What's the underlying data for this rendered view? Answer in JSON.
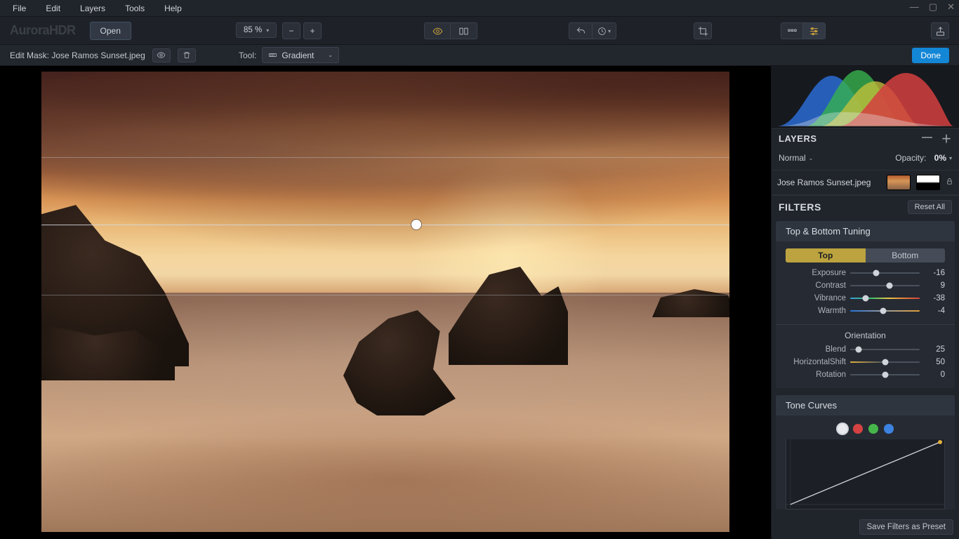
{
  "menubar": {
    "items": [
      "File",
      "Edit",
      "Layers",
      "Tools",
      "Help"
    ]
  },
  "app_logo": "AuroraHDR",
  "toolbar": {
    "open_label": "Open",
    "zoom_label": "85 %"
  },
  "subbar": {
    "editmask_prefix": "Edit Mask:",
    "filename": "Jose Ramos Sunset.jpeg",
    "tool_lbl": "Tool:",
    "tool_value": "Gradient",
    "done_label": "Done"
  },
  "layers": {
    "title": "LAYERS",
    "blend_mode": "Normal",
    "opacity_lbl": "Opacity:",
    "opacity_val": "0%",
    "layer_name": "Jose Ramos Sunset.jpeg"
  },
  "filters": {
    "title": "FILTERS",
    "reset_label": "Reset All",
    "save_preset_label": "Save Filters as Preset",
    "tbt": {
      "header": "Top & Bottom Tuning",
      "tab_top": "Top",
      "tab_bottom": "Bottom",
      "rows": [
        {
          "label": "Exposure",
          "value": "-16",
          "pos": 37
        },
        {
          "label": "Contrast",
          "value": "9",
          "pos": 57
        },
        {
          "label": "Vibrance",
          "value": "-38",
          "pos": 22,
          "track": "vib"
        },
        {
          "label": "Warmth",
          "value": "-4",
          "pos": 47,
          "track": "warm"
        }
      ],
      "orientation_header": "Orientation",
      "orientation_rows": [
        {
          "label": "Blend",
          "value": "25",
          "pos": 12
        },
        {
          "label": "HorizontalShift",
          "value": "50",
          "pos": 50,
          "track": "hshift"
        },
        {
          "label": "Rotation",
          "value": "0",
          "pos": 50
        }
      ]
    },
    "tonecurves": {
      "header": "Tone Curves"
    }
  }
}
